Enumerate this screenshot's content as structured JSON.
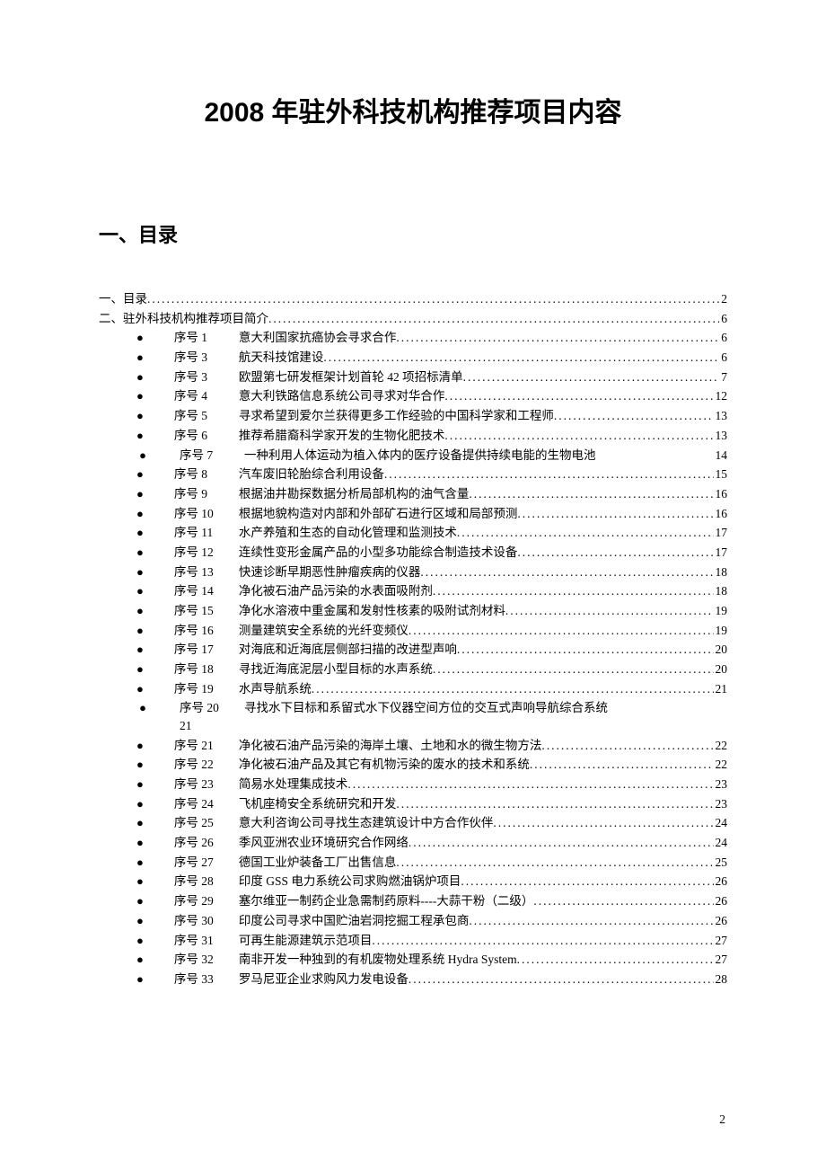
{
  "title": "2008 年驻外科技机构推荐项目内容",
  "section_heading": "一、目录",
  "page_number": "2",
  "top_entries": [
    {
      "text": "一、目录",
      "page": "2"
    },
    {
      "text": "二、驻外科技机构推荐项目简介",
      "page": "6"
    }
  ],
  "entries": [
    {
      "label": "序号 1",
      "desc": "意大利国家抗癌协会寻求合作",
      "page": "6"
    },
    {
      "label": "序号 3",
      "desc": "航天科技馆建设",
      "page": "6"
    },
    {
      "label": "序号 3",
      "desc": "欧盟第七研发框架计划首轮 42 项招标清单",
      "page": "7"
    },
    {
      "label": "序号 4",
      "desc": "意大利铁路信息系统公司寻求对华合作",
      "page": "12"
    },
    {
      "label": "序号 5",
      "desc": "寻求希望到爱尔兰获得更多工作经验的中国科学家和工程师",
      "page": "13"
    },
    {
      "label": "序号 6",
      "desc": "推荐希腊裔科学家开发的生物化肥技术",
      "page": "13"
    },
    {
      "label": "序号 7",
      "desc": "一种利用人体运动为植入体内的医疗设备提供持续电能的生物电池",
      "page": "14",
      "nodots": true
    },
    {
      "label": "序号 8",
      "desc": "汽车废旧轮胎综合利用设备",
      "page": "15"
    },
    {
      "label": "序号 9",
      "desc": "根据油井勘探数据分析局部机构的油气含量",
      "page": "16"
    },
    {
      "label": "序号 10",
      "desc": "根据地貌构造对内部和外部矿石进行区域和局部预测",
      "page": "16"
    },
    {
      "label": "序号 11",
      "desc": "水产养殖和生态的自动化管理和监测技术",
      "page": "17"
    },
    {
      "label": "序号 12",
      "desc": "连续性变形金属产品的小型多功能综合制造技术设备",
      "page": "17"
    },
    {
      "label": "序号 13",
      "desc": "快速诊断早期恶性肿瘤疾病的仪器",
      "page": "18"
    },
    {
      "label": "序号 14",
      "desc": "净化被石油产品污染的水表面吸附剂",
      "page": "18"
    },
    {
      "label": "序号 15",
      "desc": "净化水溶液中重金属和发射性核素的吸附试剂材料",
      "page": "19"
    },
    {
      "label": "序号 16",
      "desc": "测量建筑安全系统的光纤变频仪",
      "page": "19"
    },
    {
      "label": "序号 17",
      "desc": "对海底和近海底层侧部扫描的改进型声响",
      "page": "20"
    },
    {
      "label": "序号 18",
      "desc": "寻找近海底泥层小型目标的水声系统",
      "page": "20"
    },
    {
      "label": "序号 19",
      "desc": "水声导航系统",
      "page": "21"
    },
    {
      "label": "序号 20",
      "desc": "寻找水下目标和系留式水下仪器空间方位的交互式声响导航综合系统",
      "page": "",
      "nodots": true,
      "continuation": "21"
    },
    {
      "label": "序号 21",
      "desc": "净化被石油产品污染的海岸土壤、土地和水的微生物方法",
      "page": "22"
    },
    {
      "label": "序号 22",
      "desc": "净化被石油产品及其它有机物污染的废水的技术和系统",
      "page": "22"
    },
    {
      "label": "序号 23",
      "desc": "简易水处理集成技术",
      "page": "23"
    },
    {
      "label": "序号 24",
      "desc": "飞机座椅安全系统研究和开发",
      "page": "23"
    },
    {
      "label": "序号 25",
      "desc": "意大利咨询公司寻找生态建筑设计中方合作伙伴",
      "page": "24"
    },
    {
      "label": "序号 26",
      "desc": "季风亚洲农业环境研究合作网络",
      "page": "24"
    },
    {
      "label": "序号 27",
      "desc": "德国工业炉装备工厂出售信息",
      "page": "25"
    },
    {
      "label": "序号 28",
      "desc": "印度 GSS 电力系统公司求购燃油锅炉项目 ",
      "page": "26"
    },
    {
      "label": "序号 29",
      "desc": "塞尔维亚一制药企业急需制药原料----大蒜干粉（二级）",
      "page": "26"
    },
    {
      "label": "序号 30",
      "desc": "印度公司寻求中国贮油岩洞挖掘工程承包商",
      "page": "26"
    },
    {
      "label": "序号 31",
      "desc": "可再生能源建筑示范项目",
      "page": "27"
    },
    {
      "label": "序号 32",
      "desc": "南非开发一种独到的有机废物处理系统 Hydra System",
      "page": "27"
    },
    {
      "label": "序号 33",
      "desc": "罗马尼亚企业求购风力发电设备",
      "page": "28"
    }
  ]
}
